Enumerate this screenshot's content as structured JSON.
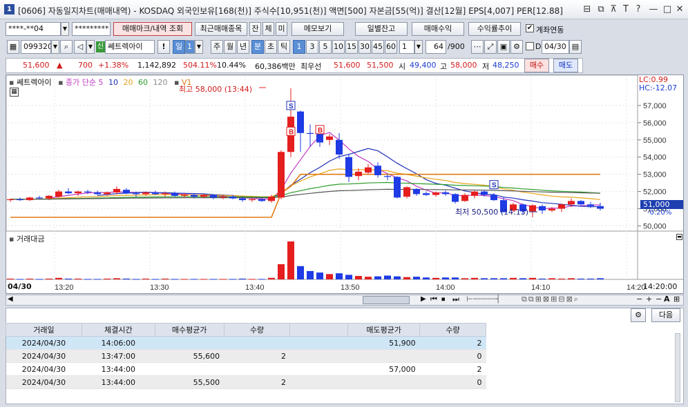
{
  "window": {
    "number": "1",
    "title": "[0606] 자동일지차트(매매내역) - KOSDAQ 외국인보유[168(천)] 주식수[10,951(천)] 액면[500] 자본금[55(억)] 결산[12월] EPS[4,007] PER[12.88]"
  },
  "toolbar1": {
    "account": "****-**04",
    "password": "*********",
    "btn_mark": "매매마크/내역 조회",
    "btn_recent": "최근매매종목",
    "btn_jan": "잔",
    "btn_che": "체",
    "btn_mi": "미",
    "btn_memo": "메모보기",
    "btn_daily": "일별잔고",
    "btn_profit": "매매수익",
    "btn_trend": "수익률추이",
    "chk_account": "계좌연동"
  },
  "toolbar2": {
    "code": "099320",
    "name": "쎄트렉아이",
    "sin": "신",
    "periods": [
      "일",
      "주",
      "월",
      "년",
      "분",
      "초",
      "틱"
    ],
    "period_sel": "1",
    "minutes": [
      "1",
      "3",
      "5",
      "10",
      "15",
      "30",
      "45",
      "60"
    ],
    "count_sel": "1",
    "count": "64",
    "count_max": "/900",
    "chk_d": "D",
    "date": "04/30"
  },
  "quote": {
    "price": "51,600",
    "arrow": "▲",
    "change": "700",
    "pct": "+1.38%",
    "volume": "1,142,892",
    "vol_pct": "504.11%",
    "turnover": "10.44%",
    "amount": "60,386백만",
    "priority": "최우선",
    "bid1": "51,600",
    "bid2": "51,500",
    "open_lbl": "시",
    "open": "49,400",
    "high_lbl": "고",
    "high": "58,000",
    "low_lbl": "저",
    "low": "48,250",
    "buy": "매수",
    "sell": "매도"
  },
  "chart": {
    "legend_name": "쎄트렉아이",
    "legend_ma": "종가 단순",
    "ma": [
      "5",
      "10",
      "20",
      "60",
      "120"
    ],
    "v1": "V1",
    "lc": "LC:0.99",
    "hc": "HC:-12.07",
    "high_note": "최고 58,000 (13:44)",
    "low_note": "최저 50,500 (14:13)",
    "current": "51,000",
    "cur_pct": "-0.20%",
    "volume_title": "거래대금",
    "date_label": "04/30",
    "time_end": "14:20:00"
  },
  "chart_data": {
    "type": "candlestick",
    "y_ticks": [
      "57,000",
      "56,000",
      "55,000",
      "54,000",
      "53,000",
      "52,000",
      "51,000",
      "50,000"
    ],
    "x_ticks": [
      "13:20",
      "13:30",
      "13:40",
      "13:50",
      "14:00",
      "14:10",
      "14:20"
    ],
    "ylim": [
      49700,
      58600
    ],
    "candles": [
      [
        51500,
        51600,
        51400,
        51550
      ],
      [
        51550,
        51650,
        51450,
        51500
      ],
      [
        51500,
        51700,
        51450,
        51650
      ],
      [
        51650,
        51750,
        51550,
        51600
      ],
      [
        51600,
        51800,
        51500,
        51750
      ],
      [
        51700,
        52100,
        51650,
        52000
      ],
      [
        52000,
        52200,
        51850,
        51900
      ],
      [
        51900,
        52050,
        51750,
        52000
      ],
      [
        52000,
        52100,
        51850,
        51950
      ],
      [
        51950,
        52050,
        51800,
        51850
      ],
      [
        51850,
        52000,
        51750,
        51950
      ],
      [
        51950,
        52300,
        51850,
        52150
      ],
      [
        52100,
        52200,
        51850,
        51900
      ],
      [
        51900,
        52000,
        51700,
        51850
      ],
      [
        51850,
        52000,
        51750,
        51950
      ],
      [
        51950,
        52050,
        51800,
        51850
      ],
      [
        51850,
        52000,
        51700,
        51900
      ],
      [
        51900,
        52000,
        51700,
        51750
      ],
      [
        51750,
        51900,
        51650,
        51800
      ],
      [
        51800,
        51900,
        51600,
        51700
      ],
      [
        51700,
        51850,
        51600,
        51800
      ],
      [
        51800,
        51850,
        51550,
        51650
      ],
      [
        51650,
        51800,
        51550,
        51700
      ],
      [
        51700,
        51800,
        51550,
        51600
      ],
      [
        51600,
        51700,
        51400,
        51500
      ],
      [
        51500,
        51600,
        51400,
        51550
      ],
      [
        51550,
        51650,
        51400,
        51450
      ],
      [
        51450,
        51800,
        51350,
        51700
      ],
      [
        51650,
        54400,
        51550,
        54300
      ],
      [
        54300,
        58000,
        54000,
        56350
      ],
      [
        56650,
        56700,
        54300,
        55400
      ],
      [
        55400,
        55900,
        54600,
        55350
      ],
      [
        55350,
        55500,
        54600,
        54850
      ],
      [
        55000,
        55350,
        54700,
        55200
      ],
      [
        55000,
        55400,
        53900,
        54150
      ],
      [
        54000,
        54200,
        52550,
        52850
      ],
      [
        52900,
        53350,
        52650,
        53150
      ],
      [
        53100,
        53600,
        53000,
        53400
      ],
      [
        53500,
        53700,
        52800,
        52950
      ],
      [
        52900,
        53000,
        52650,
        52850
      ],
      [
        52850,
        52900,
        51600,
        51650
      ],
      [
        51700,
        52300,
        51600,
        52250
      ],
      [
        52150,
        52200,
        51750,
        51850
      ],
      [
        51900,
        52000,
        51750,
        51800
      ],
      [
        51800,
        52000,
        51700,
        51950
      ],
      [
        51950,
        52050,
        51750,
        51850
      ],
      [
        51850,
        51900,
        51300,
        51400
      ],
      [
        51450,
        51900,
        51400,
        51800
      ],
      [
        51750,
        52050,
        51600,
        52000
      ],
      [
        52000,
        52100,
        51700,
        51800
      ],
      [
        51800,
        51900,
        51450,
        51500
      ],
      [
        51500,
        51650,
        50800,
        50800
      ],
      [
        50900,
        51350,
        50800,
        51250
      ],
      [
        51250,
        51300,
        50700,
        50850
      ],
      [
        50850,
        51250,
        50500,
        51200
      ],
      [
        51150,
        51250,
        50700,
        50900
      ],
      [
        50900,
        51100,
        50800,
        51000
      ],
      [
        51000,
        51300,
        50800,
        51250
      ],
      [
        51250,
        51600,
        51100,
        51450
      ],
      [
        51450,
        51500,
        51200,
        51250
      ],
      [
        51250,
        51400,
        51050,
        51150
      ],
      [
        51150,
        51350,
        50900,
        51000
      ]
    ],
    "volumes": [
      2,
      1,
      2,
      1,
      2,
      4,
      2,
      2,
      1,
      1,
      2,
      3,
      2,
      1,
      2,
      1,
      2,
      1,
      1,
      1,
      1,
      1,
      1,
      1,
      2,
      1,
      1,
      4,
      40,
      100,
      35,
      22,
      18,
      14,
      16,
      12,
      9,
      7,
      8,
      10,
      8,
      6,
      7,
      5,
      4,
      5,
      5,
      3,
      4,
      3,
      3,
      3,
      4,
      3,
      4,
      2,
      3,
      2,
      3,
      2,
      2,
      3
    ],
    "trades": [
      {
        "date": "2024/04/30",
        "time": "14:06:00",
        "buy_avg": "",
        "qty": "",
        "sell_avg": "51,900",
        "sell_qty": "2"
      },
      {
        "date": "2024/04/30",
        "time": "13:47:00",
        "buy_avg": "55,600",
        "qty": "2",
        "sell_avg": "",
        "sell_qty": "0"
      },
      {
        "date": "2024/04/30",
        "time": "13:44:00",
        "buy_avg": "",
        "qty": "",
        "sell_avg": "57,000",
        "sell_qty": "2"
      },
      {
        "date": "2024/04/30",
        "time": "13:44:00",
        "buy_avg": "55,500",
        "qty": "2",
        "sell_avg": "",
        "sell_qty": "0"
      }
    ]
  },
  "table": {
    "headers": [
      "거래일",
      "체결시간",
      "매수평균가",
      "수량",
      "",
      "매도평균가",
      "수량"
    ],
    "btn_next": "다음"
  },
  "colors": {
    "up": "#e51e1e",
    "down": "#1e3be5",
    "ma5": "#c23ac2",
    "ma10": "#1c2fb8",
    "ma20": "#e8a317",
    "ma60": "#2a9c2a",
    "ma120": "#555555",
    "v1": "#e07a10"
  }
}
